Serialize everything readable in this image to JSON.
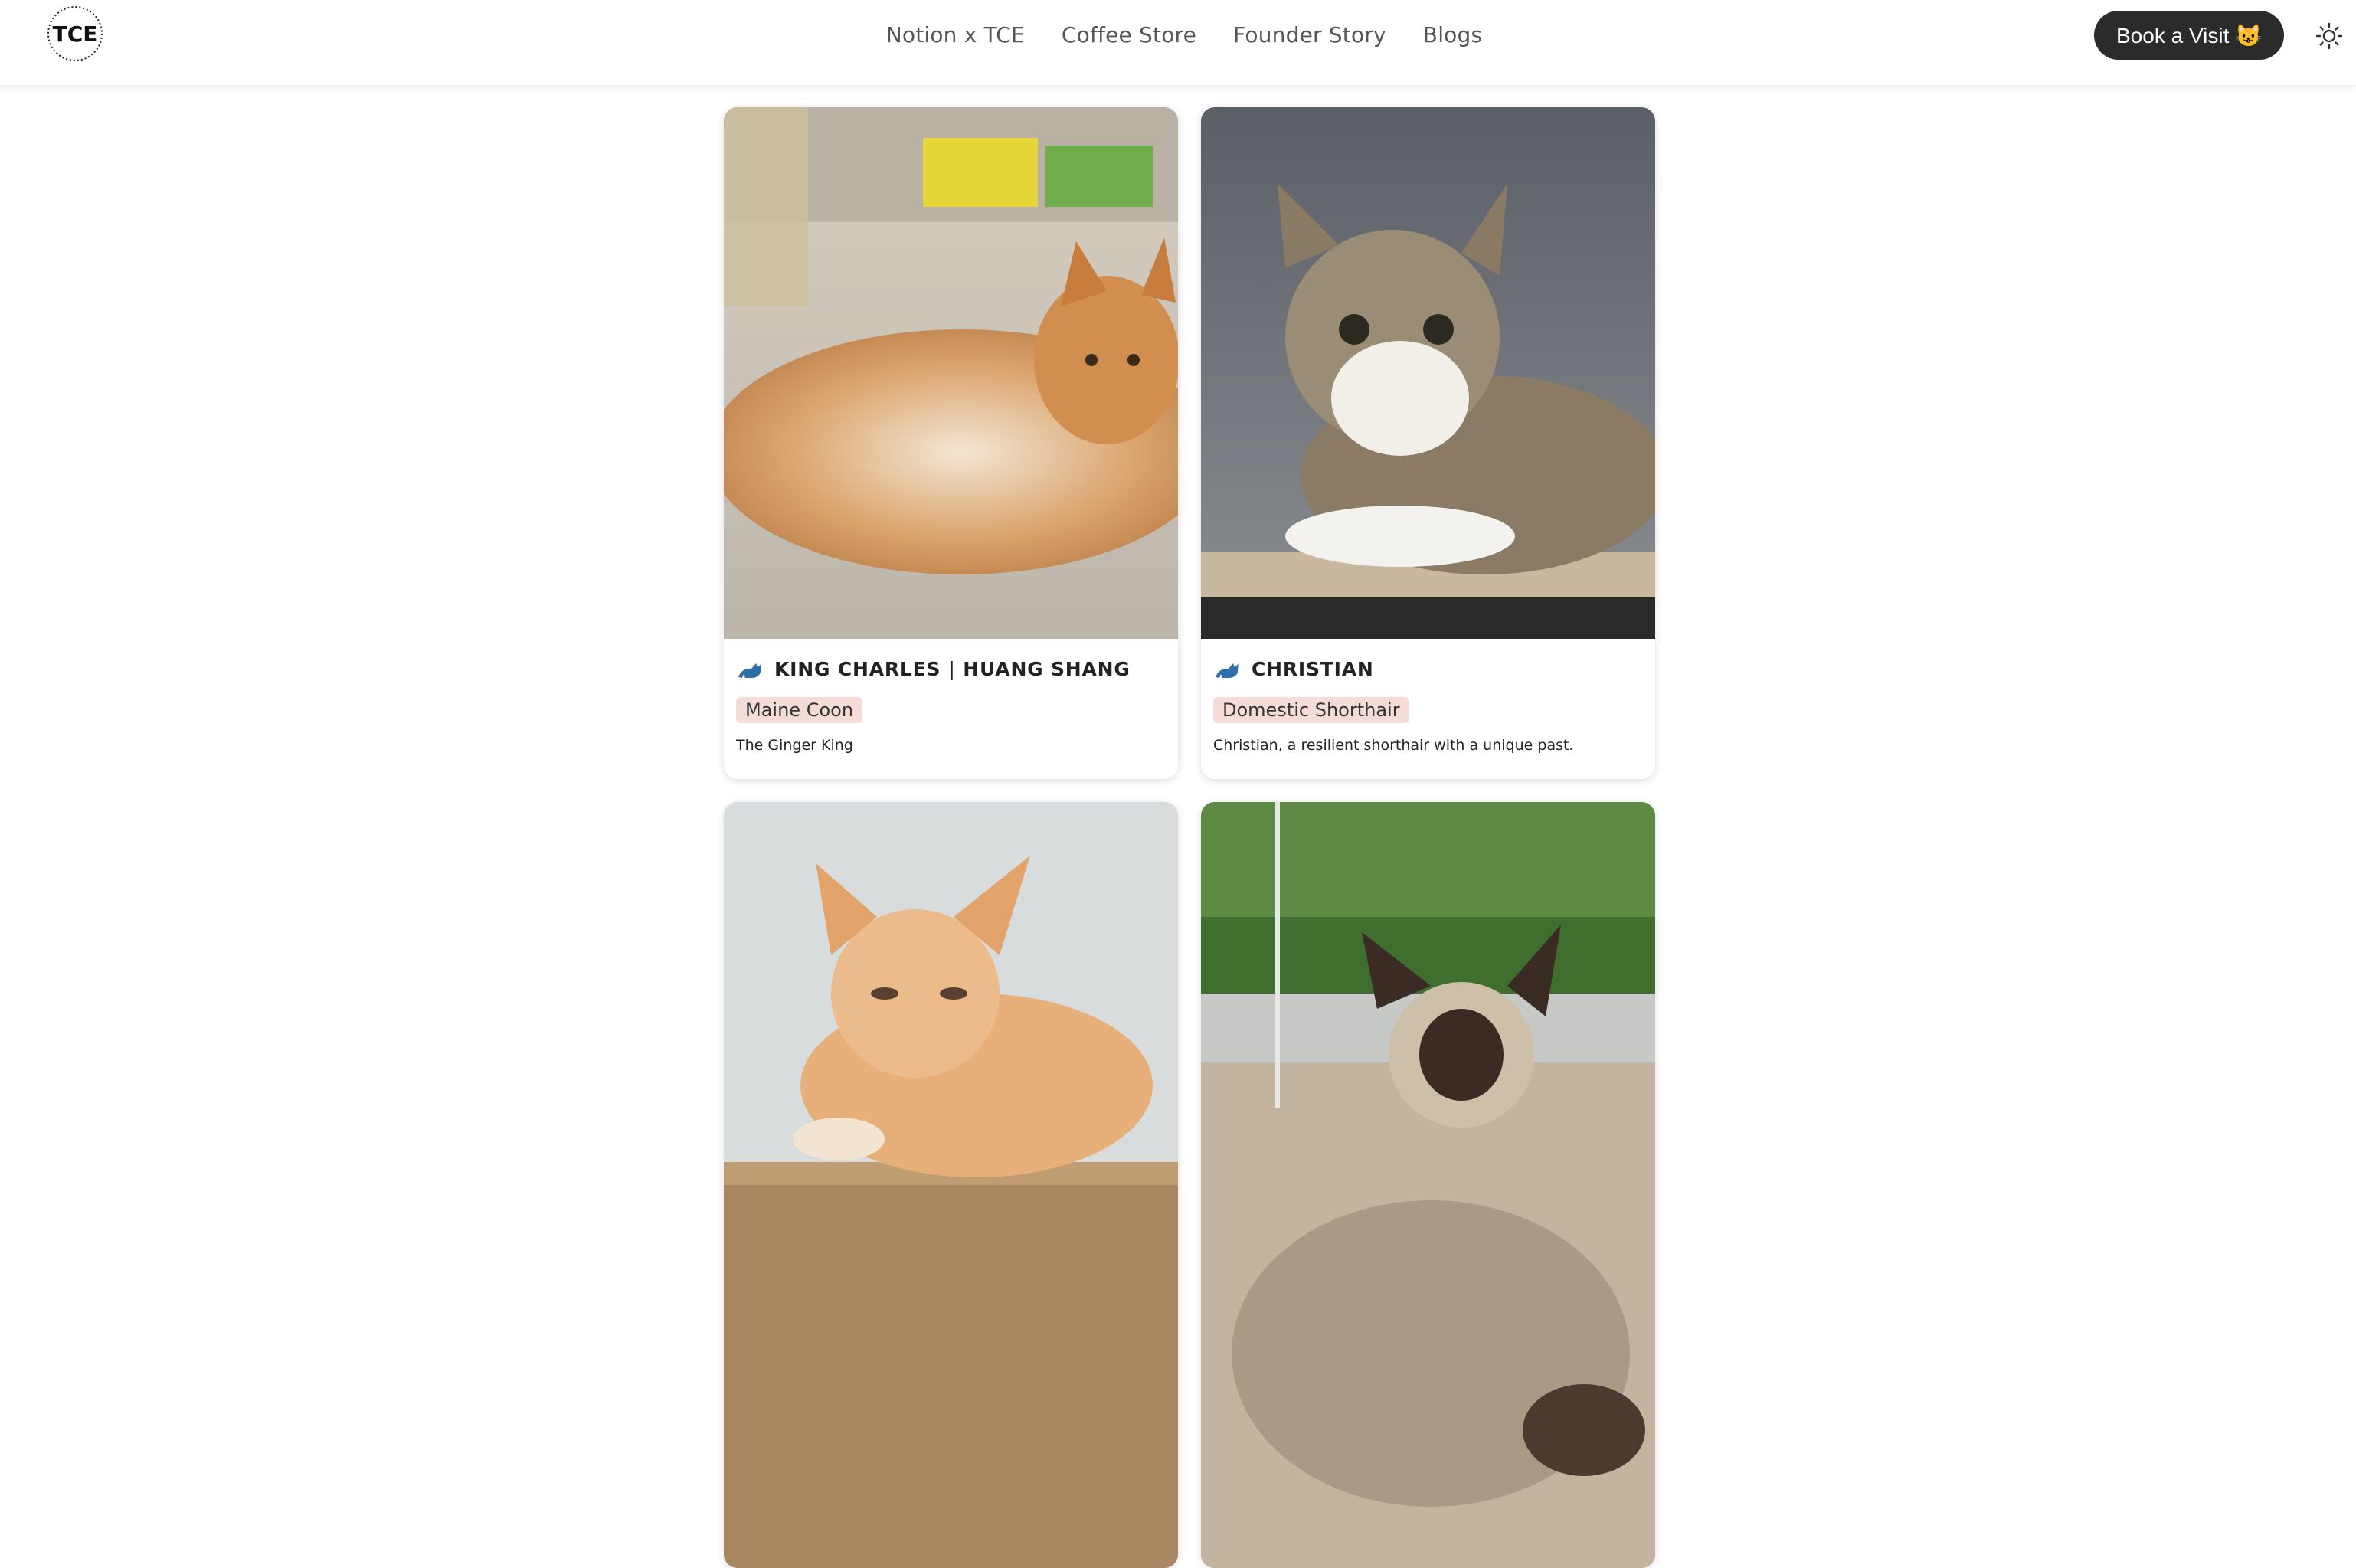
{
  "header": {
    "logo_text": "TCE",
    "nav": [
      "Notion x TCE",
      "Coffee Store",
      "Founder Story",
      "Blogs"
    ],
    "book_button": "Book a Visit 😺",
    "theme_icon": "sun-icon"
  },
  "cats": [
    {
      "name": "KING CHARLES | HUANG SHANG",
      "breed": "Maine Coon",
      "description": "The Ginger King"
    },
    {
      "name": "CHRISTIAN",
      "breed": "Domestic Shorthair",
      "description": "Christian, a resilient shorthair with a unique past."
    },
    {
      "name": "",
      "breed": "",
      "description": ""
    },
    {
      "name": "",
      "breed": "",
      "description": ""
    }
  ],
  "colors": {
    "accent": "#2b2b2b",
    "breed_badge": "#f5dcd6",
    "cat_icon": "#2f6fa8"
  }
}
